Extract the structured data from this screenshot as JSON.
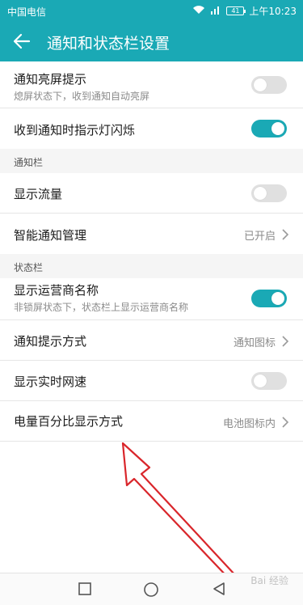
{
  "status_bar": {
    "carrier": "中国电信",
    "battery": "41",
    "time": "上午10:23",
    "icons": [
      "wifi-icon",
      "signal-icon",
      "battery-icon"
    ]
  },
  "header": {
    "title": "通知和状态栏设置",
    "back_icon": "back-arrow-icon"
  },
  "colors": {
    "accent": "#1aa9b5",
    "annotation": "#d9262b"
  },
  "rows_top": [
    {
      "label": "通知亮屏提示",
      "sub": "熄屏状态下，收到通知自动亮屏",
      "toggle": false
    },
    {
      "label": "收到通知时指示灯闪烁",
      "toggle": true
    }
  ],
  "sections": [
    {
      "header": "通知栏",
      "rows": [
        {
          "label": "显示流量",
          "toggle": false
        },
        {
          "label": "智能通知管理",
          "value": "已开启"
        }
      ]
    },
    {
      "header": "状态栏",
      "rows": [
        {
          "label": "显示运营商名称",
          "sub": "非锁屏状态下，状态栏上显示运营商名称",
          "toggle": true
        },
        {
          "label": "通知提示方式",
          "value": "通知图标"
        },
        {
          "label": "显示实时网速",
          "toggle": false
        },
        {
          "label": "电量百分比显示方式",
          "value": "电池图标内"
        }
      ]
    }
  ],
  "nav_bar": {
    "buttons": [
      "recent-apps-icon",
      "home-icon",
      "back-triangle-icon"
    ]
  },
  "watermark": "Bai 经验"
}
